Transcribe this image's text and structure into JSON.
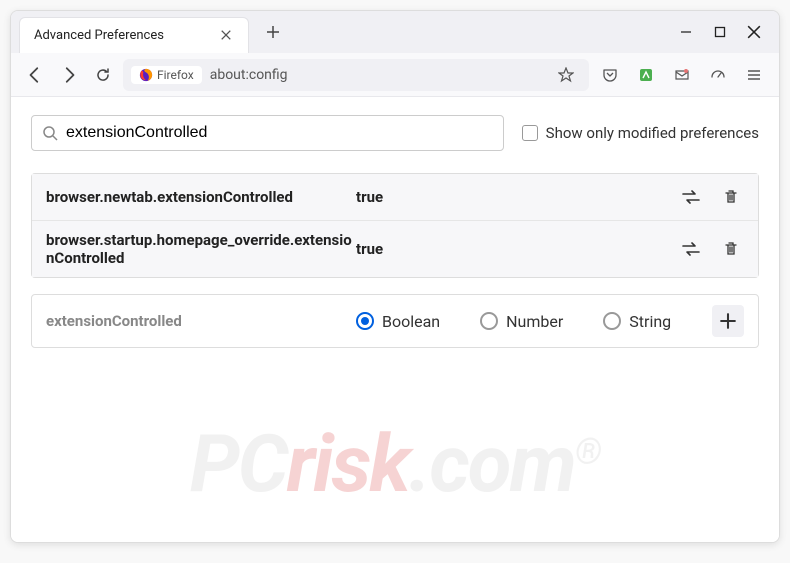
{
  "window": {
    "tab_title": "Advanced Preferences"
  },
  "toolbar": {
    "firefox_label": "Firefox",
    "url": "about:config"
  },
  "search": {
    "value": "extensionControlled",
    "checkbox_label": "Show only modified preferences"
  },
  "prefs": [
    {
      "name": "browser.newtab.extensionControlled",
      "value": "true"
    },
    {
      "name": "browser.startup.homepage_override.extensionControlled",
      "value": "true"
    }
  ],
  "new_pref": {
    "name": "extensionControlled",
    "types": [
      "Boolean",
      "Number",
      "String"
    ],
    "selected": 0
  },
  "watermark": {
    "pre": "PC",
    "red": "risk",
    "post": ".com",
    "reg": "®"
  }
}
